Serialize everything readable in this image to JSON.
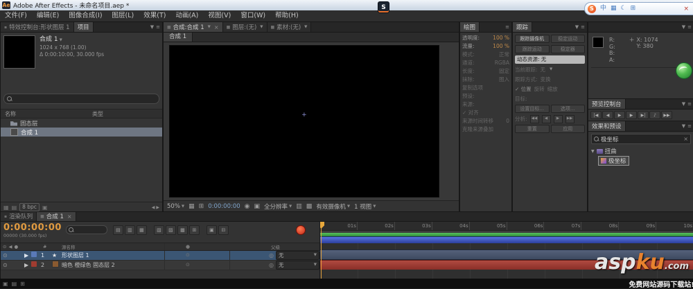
{
  "window": {
    "title": "Adobe After Effects - 未命名项目.aep *",
    "app_badge": "Ae"
  },
  "ime": {
    "logo": "S",
    "tray_logo": "S",
    "icons": [
      "中",
      "▦",
      "☾",
      "⊞"
    ],
    "close": "×"
  },
  "menu": {
    "items": [
      "文件(F)",
      "编辑(E)",
      "图像合成(I)",
      "图层(L)",
      "效果(T)",
      "动画(A)",
      "视图(V)",
      "窗口(W)",
      "帮助(H)"
    ]
  },
  "project_panel": {
    "tab_effects": "特效控制台:形状图层 1",
    "tab_project": "项目",
    "comp_name": "合成 1",
    "comp_res": "1024 x 768 (1.00)",
    "comp_time": "Δ 0:00:10:00, 30.000 fps",
    "col_name": "名称",
    "col_type": "类型",
    "items": [
      {
        "name": "固态层",
        "icon": "folder",
        "cls": ""
      },
      {
        "name": "合成 1",
        "icon": "comp",
        "cls": "selected"
      }
    ],
    "bit_depth": "8 bpc"
  },
  "comp_panel": {
    "tabs": [
      {
        "label": "合成:合成 1",
        "cls": "active"
      },
      {
        "label": "图层:(无)",
        "cls": ""
      },
      {
        "label": "素材:(无)",
        "cls": ""
      }
    ],
    "subtab": "合成 1",
    "zoom": "50%",
    "timecode": "0:00:00:00",
    "resolution": "全分辨率",
    "camera": "有效摄像机",
    "view_layout": "1 视图"
  },
  "paint_panel": {
    "tab": "绘图",
    "rows": [
      {
        "label": "透明度:",
        "value": "100 %",
        "cls": ""
      },
      {
        "label": "流量:",
        "value": "100 %",
        "cls": ""
      },
      {
        "label": "模式:",
        "value": "正常",
        "cls": "dim"
      },
      {
        "label": "通道:",
        "value": "RGBA",
        "cls": "dim"
      },
      {
        "label": "长度:",
        "value": "固定",
        "cls": "dim"
      },
      {
        "label": "抹除:",
        "value": "图入",
        "cls": "dim"
      },
      {
        "label": "复制选项",
        "value": "",
        "cls": "dim"
      },
      {
        "label": "预设:",
        "value": "",
        "cls": "dim"
      },
      {
        "label": "来源:",
        "value": "",
        "cls": "dim"
      },
      {
        "label": "✓ 对齐",
        "value": "",
        "cls": "dim"
      },
      {
        "label": "来源时间转移",
        "value": "0",
        "cls": "dim"
      },
      {
        "label": "克隆来源叠加",
        "value": "",
        "cls": "dim"
      }
    ]
  },
  "tracker_panel": {
    "tab": "跟踪",
    "btn_track_camera": "跟踪摄像机",
    "btn_stabilize_motion": "稳定运动",
    "btn_track_motion": "跟踪运动",
    "btn_stabilizer": "稳定器",
    "motion_source": "动态资源: 无",
    "current_track_label": "当前跟踪:",
    "current_track_value": "无",
    "track_type_label": "跟踪方式:",
    "track_type_value": "变换",
    "check_position": "✓ 位置",
    "check_rotation": "旋转",
    "check_scale": "缩放",
    "target_label": "目标:",
    "btn_edit_target": "设置目标...",
    "btn_options": "选项...",
    "analyze_label": "分析:",
    "btn_reset": "重置",
    "btn_apply": "应用"
  },
  "info_panel": {
    "r": "R:",
    "g": "G:",
    "b": "B:",
    "a": "A:",
    "x": "X: 1074",
    "y": "Y: 380"
  },
  "preview_panel": {
    "title": "预览控制台",
    "buttons": [
      "|◀",
      "◀",
      "▶",
      "▶",
      "▶|",
      "♪",
      "▶▶"
    ]
  },
  "effects_panel": {
    "title": "效果和预设",
    "search_value": "极坐标",
    "group": "扭曲",
    "item": "极坐标"
  },
  "timeline": {
    "tab_render_queue": "渲染队列",
    "tab_comp": "合成 1",
    "timecode": "0:00:00:00",
    "frames": "00000 (30.000 fps)",
    "col_num": "#",
    "col_source": "源名称",
    "col_parent": "父级",
    "layers": [
      {
        "num": "1",
        "name": "形状图层 1",
        "parent": "无"
      },
      {
        "num": "2",
        "name": "暗色 橙绿色 固态层 2",
        "parent": "无"
      }
    ],
    "ruler": [
      "01s",
      "02s",
      "03s",
      "04s",
      "05s",
      "06s",
      "07s",
      "08s",
      "09s",
      "10s"
    ]
  },
  "watermark": {
    "brand_a": "asp",
    "brand_b": "ku",
    "brand_suffix": ".com",
    "tagline": "免费网站源码下载站!"
  },
  "colors": {
    "accent_orange": "#e09a40",
    "selection_blue": "#3b5674",
    "bar_green": "#3f9b46",
    "bar_blue": "#3c55c8",
    "bar_red": "#9e3a35"
  }
}
